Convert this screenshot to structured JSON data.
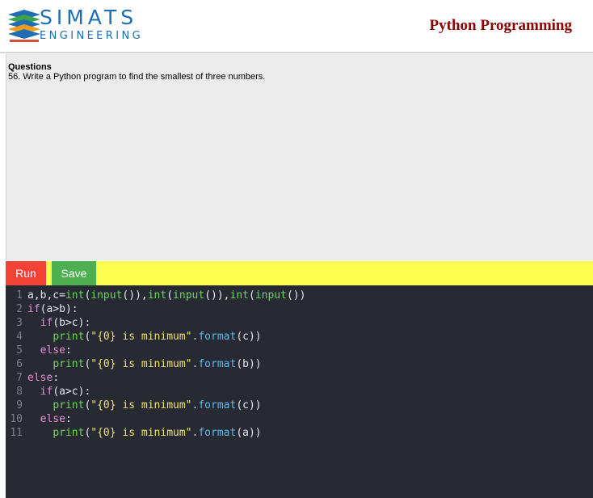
{
  "header": {
    "brand_name": "SIMATS",
    "brand_sub": "ENGINEERING",
    "page_title": "Python Programming"
  },
  "question": {
    "heading": "Questions",
    "text": "56. Write a Python program to find the smallest of three numbers."
  },
  "toolbar": {
    "run_label": "Run",
    "save_label": "Save"
  },
  "editor": {
    "lines": [
      {
        "num": "1",
        "indent": "",
        "tokens": [
          [
            "v",
            "a,b,c="
          ],
          [
            "f",
            "int"
          ],
          [
            "p",
            "("
          ],
          [
            "f",
            "input"
          ],
          [
            "p",
            "()),"
          ],
          [
            "f",
            "int"
          ],
          [
            "p",
            "("
          ],
          [
            "f",
            "input"
          ],
          [
            "p",
            "()),"
          ],
          [
            "f",
            "int"
          ],
          [
            "p",
            "("
          ],
          [
            "f",
            "input"
          ],
          [
            "p",
            "())"
          ]
        ]
      },
      {
        "num": "2",
        "indent": "",
        "tokens": [
          [
            "k",
            "if"
          ],
          [
            "p",
            "(a>b):"
          ]
        ]
      },
      {
        "num": "3",
        "indent": "  ",
        "tokens": [
          [
            "k",
            "if"
          ],
          [
            "p",
            "(b>c):"
          ]
        ]
      },
      {
        "num": "4",
        "indent": "    ",
        "tokens": [
          [
            "f",
            "print"
          ],
          [
            "p",
            "("
          ],
          [
            "s",
            "\"{0} is minimum\""
          ],
          [
            "p",
            "."
          ],
          [
            "m",
            "format"
          ],
          [
            "p",
            "(c))"
          ]
        ]
      },
      {
        "num": "5",
        "indent": "  ",
        "tokens": [
          [
            "k",
            "else"
          ],
          [
            "p",
            ":"
          ]
        ]
      },
      {
        "num": "6",
        "indent": "    ",
        "tokens": [
          [
            "f",
            "print"
          ],
          [
            "p",
            "("
          ],
          [
            "s",
            "\"{0} is minimum\""
          ],
          [
            "p",
            "."
          ],
          [
            "m",
            "format"
          ],
          [
            "p",
            "(b))"
          ]
        ]
      },
      {
        "num": "7",
        "indent": "",
        "tokens": [
          [
            "k",
            "else"
          ],
          [
            "p",
            ":"
          ]
        ]
      },
      {
        "num": "8",
        "indent": "  ",
        "tokens": [
          [
            "k",
            "if"
          ],
          [
            "p",
            "(a>c):"
          ]
        ]
      },
      {
        "num": "9",
        "indent": "    ",
        "tokens": [
          [
            "f",
            "print"
          ],
          [
            "p",
            "("
          ],
          [
            "s",
            "\"{0} is minimum\""
          ],
          [
            "p",
            "."
          ],
          [
            "m",
            "format"
          ],
          [
            "p",
            "(c))"
          ]
        ]
      },
      {
        "num": "10",
        "indent": "  ",
        "tokens": [
          [
            "k",
            "else"
          ],
          [
            "p",
            ":"
          ]
        ]
      },
      {
        "num": "11",
        "indent": "    ",
        "tokens": [
          [
            "f",
            "print"
          ],
          [
            "p",
            "("
          ],
          [
            "s",
            "\"{0} is minimum\""
          ],
          [
            "p",
            "."
          ],
          [
            "m",
            "format"
          ],
          [
            "p",
            "(a))"
          ]
        ]
      }
    ]
  },
  "colors": {
    "title_red": "#8b0000",
    "brand_blue": "#1f6db2",
    "run_red": "#f44336",
    "save_green": "#4caf50",
    "toolbar_yellow": "#ffff4d",
    "editor_bg": "#272a33"
  },
  "icons": {
    "logo": "simats-logo-icon"
  }
}
